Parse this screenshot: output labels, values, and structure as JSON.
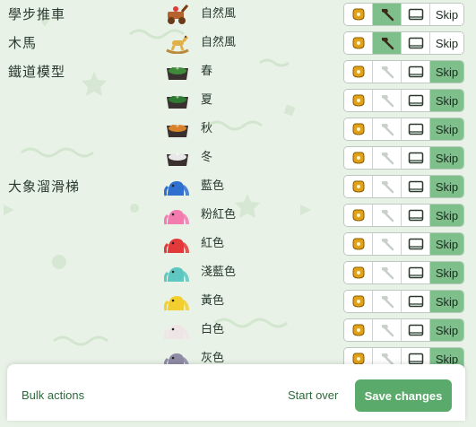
{
  "rows": [
    {
      "group": "學步推車",
      "variant": "自然風",
      "icon": "toddler-walker-icon",
      "color": "#b5622e",
      "craft_active": true,
      "skip_active": false
    },
    {
      "group": "木馬",
      "variant": "自然風",
      "icon": "rocking-horse-icon",
      "color": "#e2b04a",
      "craft_active": true,
      "skip_active": false
    },
    {
      "group": "鐵道模型",
      "variant": "春",
      "icon": "train-set-icon",
      "color": "#3f8a3a",
      "craft_active": false,
      "skip_active": true
    },
    {
      "group": "",
      "variant": "夏",
      "icon": "train-set-icon",
      "color": "#2f7a32",
      "craft_active": false,
      "skip_active": true
    },
    {
      "group": "",
      "variant": "秋",
      "icon": "train-set-icon",
      "color": "#d8822a",
      "craft_active": false,
      "skip_active": true
    },
    {
      "group": "",
      "variant": "冬",
      "icon": "train-set-icon",
      "color": "#e8e8e8",
      "craft_active": false,
      "skip_active": true
    },
    {
      "group": "大象溜滑梯",
      "variant": "藍色",
      "icon": "elephant-slide-icon",
      "color": "#2f6fd0",
      "craft_active": false,
      "skip_active": true
    },
    {
      "group": "",
      "variant": "粉紅色",
      "icon": "elephant-slide-icon",
      "color": "#f27bb0",
      "craft_active": false,
      "skip_active": true
    },
    {
      "group": "",
      "variant": "紅色",
      "icon": "elephant-slide-icon",
      "color": "#e23a3a",
      "craft_active": false,
      "skip_active": true
    },
    {
      "group": "",
      "variant": "淺藍色",
      "icon": "elephant-slide-icon",
      "color": "#5ec7c1",
      "craft_active": false,
      "skip_active": true
    },
    {
      "group": "",
      "variant": "黃色",
      "icon": "elephant-slide-icon",
      "color": "#f2cf2e",
      "craft_active": false,
      "skip_active": true
    },
    {
      "group": "",
      "variant": "白色",
      "icon": "elephant-slide-icon",
      "color": "#efe4e6",
      "craft_active": false,
      "skip_active": true
    },
    {
      "group": "",
      "variant": "灰色",
      "icon": "elephant-slide-icon",
      "color": "#8f8aa6",
      "craft_active": false,
      "skip_active": true
    }
  ],
  "skip_label": "Skip",
  "footer": {
    "bulk_label": "Bulk actions",
    "start_over_label": "Start over",
    "save_label": "Save changes"
  },
  "colors": {
    "background": "#e8f2e6",
    "active_button": "#7fbf8c",
    "save_button": "#5aaa6b",
    "link_text": "#2e6a3c",
    "catalog_icon": "#e0a21a"
  }
}
